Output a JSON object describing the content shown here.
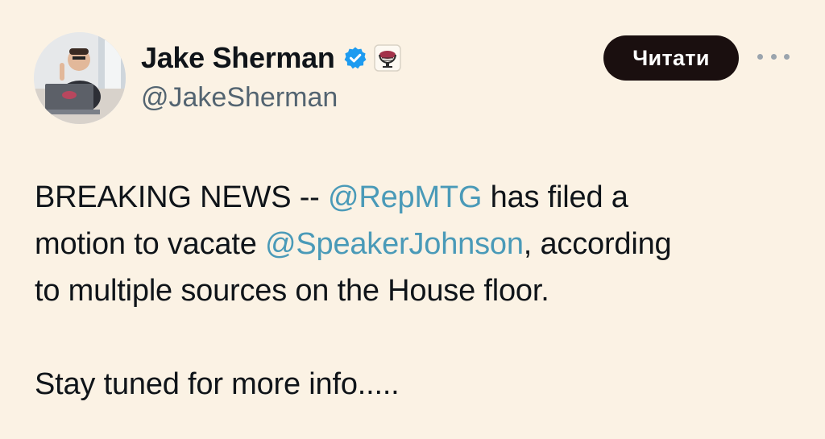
{
  "author": {
    "display_name": "Jake Sherman",
    "handle": "@JakeSherman",
    "verified_icon": "verified-badge-icon",
    "affiliate_icon": "punchbowl-affiliate-icon"
  },
  "actions": {
    "follow_label": "Читати",
    "more_icon": "more-options-icon"
  },
  "tweet": {
    "line1_prefix": "BREAKING NEWS -- ",
    "mention1": "@RepMTG",
    "line1_suffix": " has filed a",
    "line2_prefix": "motion to vacate ",
    "mention2": "@SpeakerJohnson",
    "line2_suffix": ", according",
    "line3": "to multiple sources on the House floor.",
    "line5": "Stay tuned for more info....."
  },
  "colors": {
    "background": "#fbf2e4",
    "mention": "#4a9ab8",
    "verified": "#1d9bf0",
    "button": "#1a0f0f"
  }
}
